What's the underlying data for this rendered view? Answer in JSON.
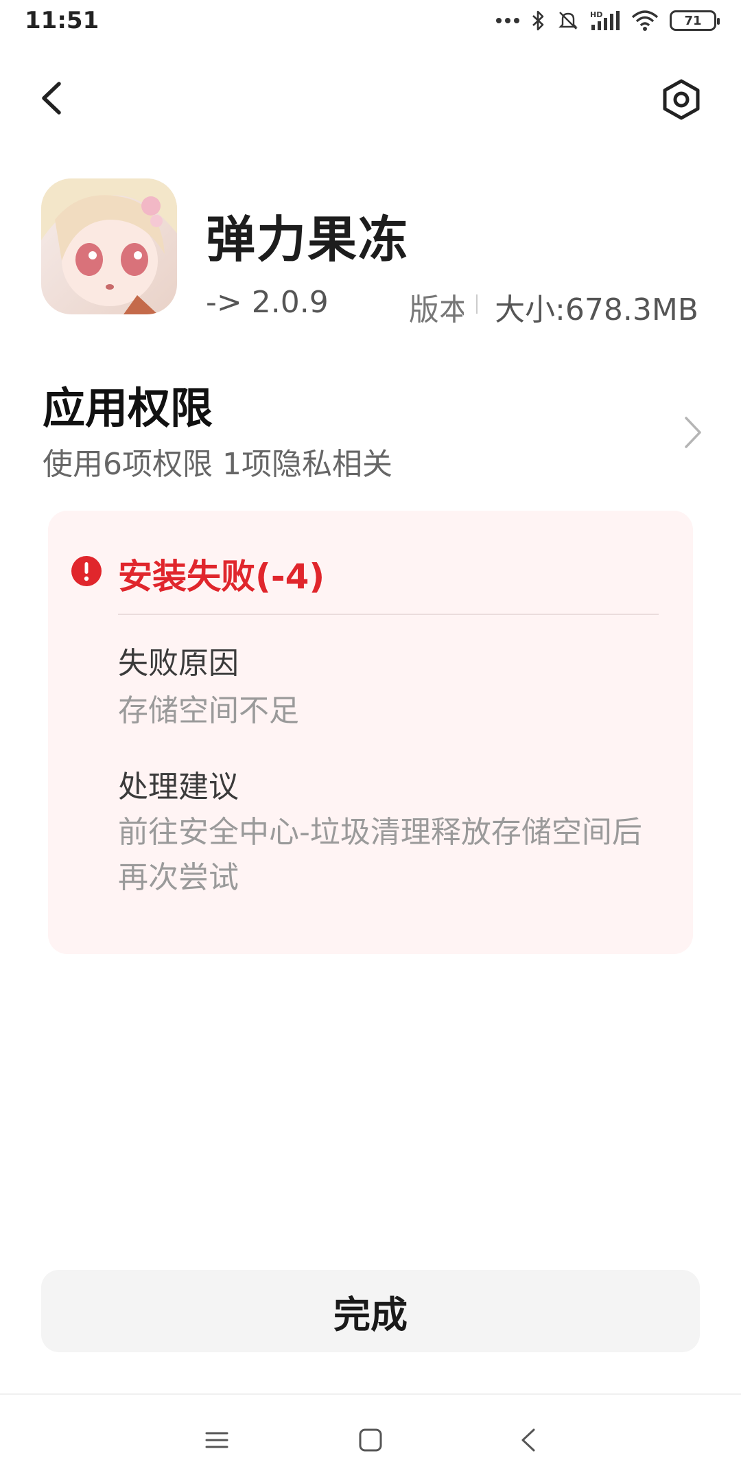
{
  "status_bar": {
    "time": "11:51",
    "battery": "71",
    "icons": [
      "more-dots-icon",
      "bluetooth-icon",
      "mute-bell-icon",
      "hd-signal-icon",
      "wifi-icon",
      "battery-icon"
    ]
  },
  "header": {
    "back_icon": "back-arrow-icon",
    "settings_icon": "settings-gear-icon"
  },
  "app": {
    "name": "弹力果冻",
    "version": "-> 2.0.9",
    "version_label": "版本",
    "size": "大小:678.3MB"
  },
  "permissions": {
    "title": "应用权限",
    "summary": "使用6项权限 1项隐私相关"
  },
  "error": {
    "title": "安装失败(-4)",
    "reason_label": "失败原因",
    "reason_value": "存储空间不足",
    "advice_label": "处理建议",
    "advice_value": "前往安全中心-垃圾清理释放存储空间后再次尝试"
  },
  "actions": {
    "done_label": "完成"
  },
  "colors": {
    "error_red": "#e0262c",
    "card_background": "#fff4f4",
    "button_background": "#f4f4f4"
  }
}
